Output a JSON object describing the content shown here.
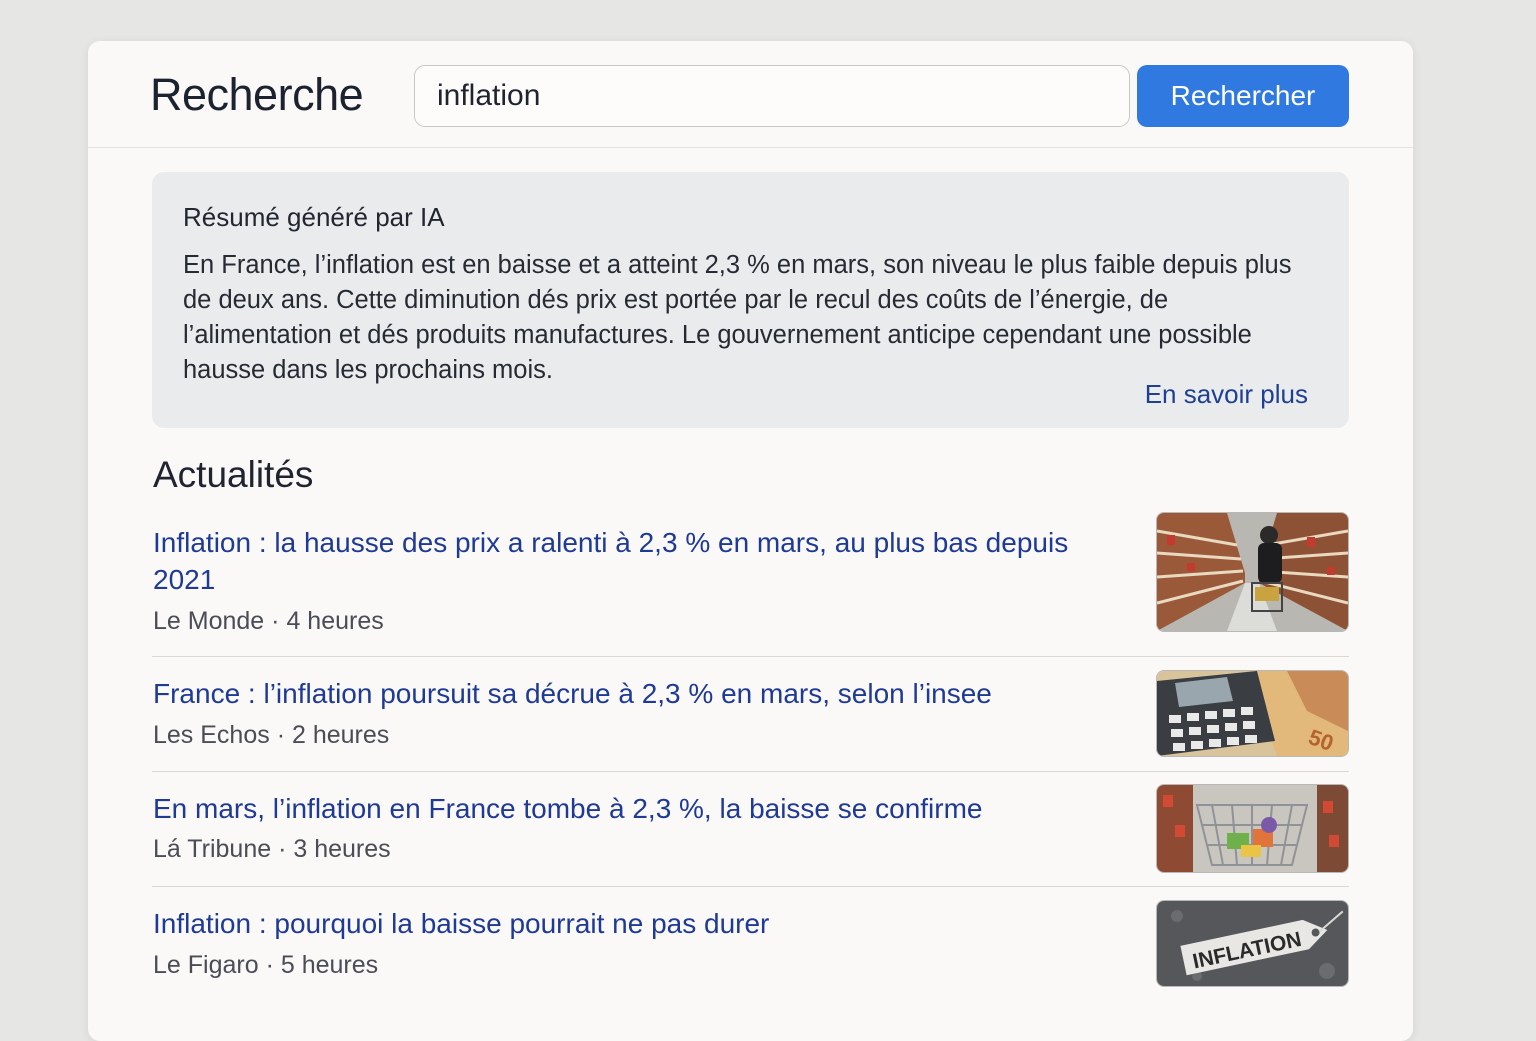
{
  "header": {
    "title": "Recherche",
    "search_value": "inflation",
    "search_button": "Rechercher"
  },
  "ai_summary": {
    "title": "Résumé généré par IA",
    "text": "En France, l’inflation est en baisse et a atteint 2,3 % en mars, son niveau le plus faible depuis plus de deux ans. Cette diminution dés prix est portée par le recul des coûts de l’énergie, de l’alimentation et dés produits manufactures. Le gouvernement anticipe cependant une possible hausse dans les prochains mois.",
    "more_link": "En savoir plus"
  },
  "news": {
    "heading": "Actualités",
    "items": [
      {
        "title": "Inflation : la hausse des prix a ralenti à 2,3 % en mars, au plus bas depuis 2021",
        "source": "Le Monde",
        "age": "4 heures",
        "thumb_icon": "supermarket-aisle-image"
      },
      {
        "title": "France : l’inflation poursuit sa décrue à 2,3 % en mars, selon l’insee",
        "source": "Les Echos",
        "age": "2 heures",
        "thumb_icon": "calculator-banknotes-image"
      },
      {
        "title": "En mars, l’inflation en France tombe à 2,3 %, la baisse se confirme",
        "source": "Lá Tribune",
        "age": "3 heures",
        "thumb_icon": "shopping-cart-image"
      },
      {
        "title": "Inflation : pourquoi la baisse pourrait ne pas durer",
        "source": "Le Figaro",
        "age": "5 heures",
        "thumb_icon": "inflation-price-tag-image",
        "thumb_label": "INFLATION"
      }
    ]
  },
  "colors": {
    "accent": "#2f79e0",
    "link": "#1e3a95",
    "ai_box_bg": "#eaebed"
  }
}
